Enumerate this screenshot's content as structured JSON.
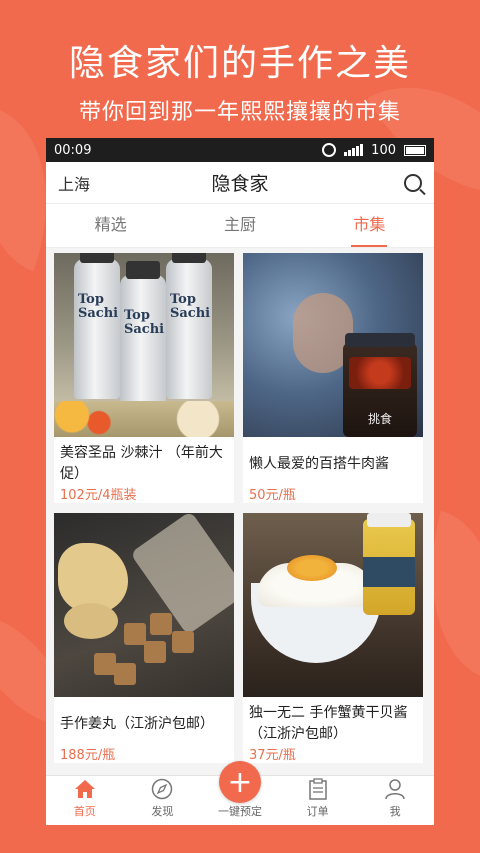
{
  "promo": {
    "title": "隐食家们的手作之美",
    "subtitle": "带你回到那一年熙熙攘攘的市集"
  },
  "statusbar": {
    "time": "00:09",
    "battery": "100"
  },
  "header": {
    "city": "上海",
    "title": "隐食家"
  },
  "tabs": [
    {
      "label": "精选"
    },
    {
      "label": "主厨"
    },
    {
      "label": "市集"
    }
  ],
  "products": [
    {
      "name": "美容圣品 沙棘汁 （年前大促）",
      "price": "102元/4瓶装",
      "photo_text": "Top Sachi"
    },
    {
      "name": "懒人最爱的百搭牛肉酱",
      "price": "50元/瓶",
      "photo_text": "挑食"
    },
    {
      "name": "手作姜丸（江浙沪包邮）",
      "price": "188元/瓶"
    },
    {
      "name": "独一无二 手作蟹黄干贝酱（江浙沪包邮）",
      "price": "37元/瓶"
    }
  ],
  "tabbar": {
    "home": "首页",
    "discover": "发现",
    "reserve": "一键预定",
    "orders": "订单",
    "me": "我"
  },
  "colors": {
    "accent": "#f26a4d"
  }
}
